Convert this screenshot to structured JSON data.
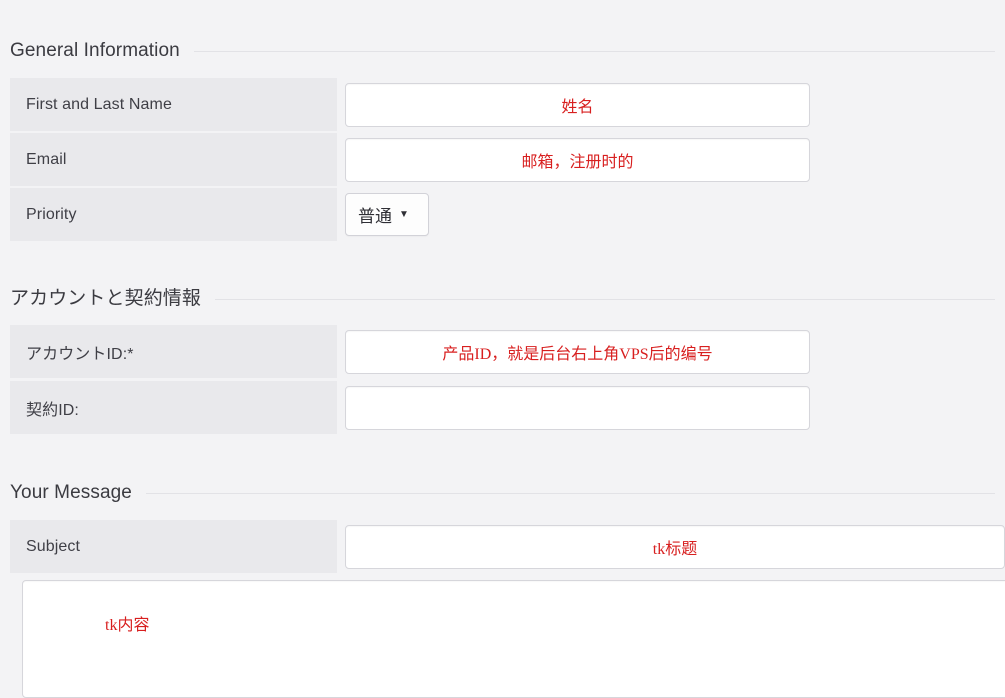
{
  "sections": [
    {
      "title": "General Information"
    },
    {
      "title": "アカウントと契約情報"
    },
    {
      "title": "Your Message"
    }
  ],
  "general": {
    "rows": [
      {
        "label": "First and Last Name",
        "value": "姓名"
      },
      {
        "label": "Email",
        "value": "邮箱，注册时的"
      },
      {
        "label": "Priority",
        "value": "普通"
      }
    ]
  },
  "priority_select": {
    "selected": "普通",
    "caret": "▼"
  },
  "account": {
    "rows": [
      {
        "label": "アカウントID:*",
        "value": "产品ID，就是后台右上角VPS后的编号"
      },
      {
        "label": "契約ID:",
        "value": ""
      }
    ]
  },
  "message": {
    "subject_label": "Subject",
    "subject_value": "tk标题",
    "body_value": "tk内容"
  },
  "colors": {
    "page_bg": "#f3f3f5",
    "label_bg": "#e9e9ec",
    "input_border": "#d6d6db",
    "text": "#3f3f46",
    "accent_red": "#d81f1f",
    "rule": "#e2e2e6"
  }
}
